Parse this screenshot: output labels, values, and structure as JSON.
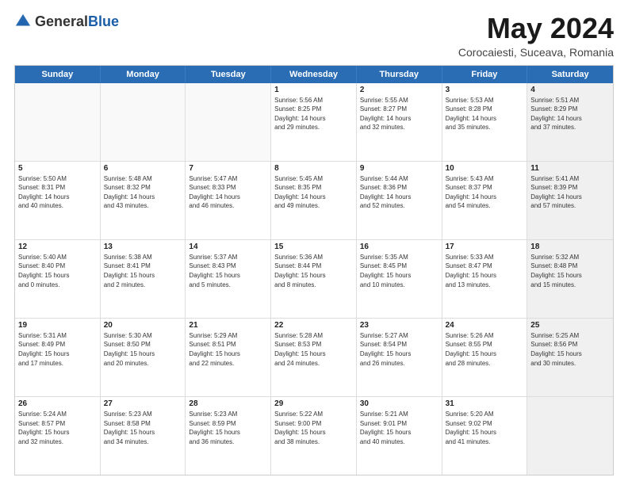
{
  "header": {
    "logo_general": "General",
    "logo_blue": "Blue",
    "month_year": "May 2024",
    "location": "Corocaiesti, Suceava, Romania"
  },
  "calendar": {
    "days_of_week": [
      "Sunday",
      "Monday",
      "Tuesday",
      "Wednesday",
      "Thursday",
      "Friday",
      "Saturday"
    ],
    "weeks": [
      [
        {
          "day": "",
          "info": "",
          "empty": true
        },
        {
          "day": "",
          "info": "",
          "empty": true
        },
        {
          "day": "",
          "info": "",
          "empty": true
        },
        {
          "day": "1",
          "info": "Sunrise: 5:56 AM\nSunset: 8:25 PM\nDaylight: 14 hours\nand 29 minutes."
        },
        {
          "day": "2",
          "info": "Sunrise: 5:55 AM\nSunset: 8:27 PM\nDaylight: 14 hours\nand 32 minutes."
        },
        {
          "day": "3",
          "info": "Sunrise: 5:53 AM\nSunset: 8:28 PM\nDaylight: 14 hours\nand 35 minutes."
        },
        {
          "day": "4",
          "info": "Sunrise: 5:51 AM\nSunset: 8:29 PM\nDaylight: 14 hours\nand 37 minutes.",
          "shaded": true
        }
      ],
      [
        {
          "day": "5",
          "info": "Sunrise: 5:50 AM\nSunset: 8:31 PM\nDaylight: 14 hours\nand 40 minutes."
        },
        {
          "day": "6",
          "info": "Sunrise: 5:48 AM\nSunset: 8:32 PM\nDaylight: 14 hours\nand 43 minutes."
        },
        {
          "day": "7",
          "info": "Sunrise: 5:47 AM\nSunset: 8:33 PM\nDaylight: 14 hours\nand 46 minutes."
        },
        {
          "day": "8",
          "info": "Sunrise: 5:45 AM\nSunset: 8:35 PM\nDaylight: 14 hours\nand 49 minutes."
        },
        {
          "day": "9",
          "info": "Sunrise: 5:44 AM\nSunset: 8:36 PM\nDaylight: 14 hours\nand 52 minutes."
        },
        {
          "day": "10",
          "info": "Sunrise: 5:43 AM\nSunset: 8:37 PM\nDaylight: 14 hours\nand 54 minutes."
        },
        {
          "day": "11",
          "info": "Sunrise: 5:41 AM\nSunset: 8:39 PM\nDaylight: 14 hours\nand 57 minutes.",
          "shaded": true
        }
      ],
      [
        {
          "day": "12",
          "info": "Sunrise: 5:40 AM\nSunset: 8:40 PM\nDaylight: 15 hours\nand 0 minutes."
        },
        {
          "day": "13",
          "info": "Sunrise: 5:38 AM\nSunset: 8:41 PM\nDaylight: 15 hours\nand 2 minutes."
        },
        {
          "day": "14",
          "info": "Sunrise: 5:37 AM\nSunset: 8:43 PM\nDaylight: 15 hours\nand 5 minutes."
        },
        {
          "day": "15",
          "info": "Sunrise: 5:36 AM\nSunset: 8:44 PM\nDaylight: 15 hours\nand 8 minutes."
        },
        {
          "day": "16",
          "info": "Sunrise: 5:35 AM\nSunset: 8:45 PM\nDaylight: 15 hours\nand 10 minutes."
        },
        {
          "day": "17",
          "info": "Sunrise: 5:33 AM\nSunset: 8:47 PM\nDaylight: 15 hours\nand 13 minutes."
        },
        {
          "day": "18",
          "info": "Sunrise: 5:32 AM\nSunset: 8:48 PM\nDaylight: 15 hours\nand 15 minutes.",
          "shaded": true
        }
      ],
      [
        {
          "day": "19",
          "info": "Sunrise: 5:31 AM\nSunset: 8:49 PM\nDaylight: 15 hours\nand 17 minutes."
        },
        {
          "day": "20",
          "info": "Sunrise: 5:30 AM\nSunset: 8:50 PM\nDaylight: 15 hours\nand 20 minutes."
        },
        {
          "day": "21",
          "info": "Sunrise: 5:29 AM\nSunset: 8:51 PM\nDaylight: 15 hours\nand 22 minutes."
        },
        {
          "day": "22",
          "info": "Sunrise: 5:28 AM\nSunset: 8:53 PM\nDaylight: 15 hours\nand 24 minutes."
        },
        {
          "day": "23",
          "info": "Sunrise: 5:27 AM\nSunset: 8:54 PM\nDaylight: 15 hours\nand 26 minutes."
        },
        {
          "day": "24",
          "info": "Sunrise: 5:26 AM\nSunset: 8:55 PM\nDaylight: 15 hours\nand 28 minutes."
        },
        {
          "day": "25",
          "info": "Sunrise: 5:25 AM\nSunset: 8:56 PM\nDaylight: 15 hours\nand 30 minutes.",
          "shaded": true
        }
      ],
      [
        {
          "day": "26",
          "info": "Sunrise: 5:24 AM\nSunset: 8:57 PM\nDaylight: 15 hours\nand 32 minutes."
        },
        {
          "day": "27",
          "info": "Sunrise: 5:23 AM\nSunset: 8:58 PM\nDaylight: 15 hours\nand 34 minutes."
        },
        {
          "day": "28",
          "info": "Sunrise: 5:23 AM\nSunset: 8:59 PM\nDaylight: 15 hours\nand 36 minutes."
        },
        {
          "day": "29",
          "info": "Sunrise: 5:22 AM\nSunset: 9:00 PM\nDaylight: 15 hours\nand 38 minutes."
        },
        {
          "day": "30",
          "info": "Sunrise: 5:21 AM\nSunset: 9:01 PM\nDaylight: 15 hours\nand 40 minutes."
        },
        {
          "day": "31",
          "info": "Sunrise: 5:20 AM\nSunset: 9:02 PM\nDaylight: 15 hours\nand 41 minutes."
        },
        {
          "day": "",
          "info": "",
          "empty": true,
          "shaded": true
        }
      ]
    ]
  }
}
